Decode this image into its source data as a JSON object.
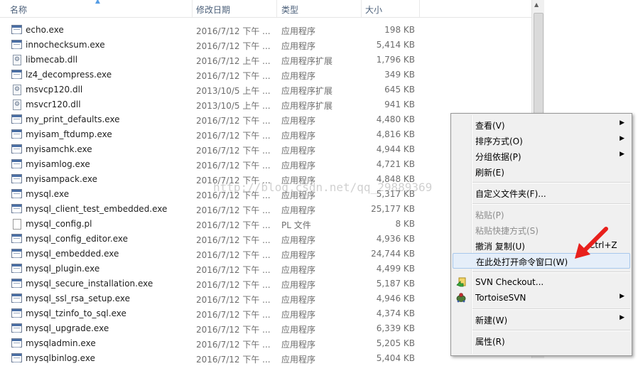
{
  "columns": {
    "name": "名称",
    "date": "修改日期",
    "type": "类型",
    "size": "大小"
  },
  "files": [
    {
      "name": "echo.exe",
      "date": "2016/7/12 下午 ...",
      "type": "应用程序",
      "size": "198 KB",
      "icon": "exe"
    },
    {
      "name": "innochecksum.exe",
      "date": "2016/7/12 下午 ...",
      "type": "应用程序",
      "size": "5,414 KB",
      "icon": "exe"
    },
    {
      "name": "libmecab.dll",
      "date": "2016/7/12 上午 ...",
      "type": "应用程序扩展",
      "size": "1,796 KB",
      "icon": "dll"
    },
    {
      "name": "lz4_decompress.exe",
      "date": "2016/7/12 下午 ...",
      "type": "应用程序",
      "size": "349 KB",
      "icon": "exe"
    },
    {
      "name": "msvcp120.dll",
      "date": "2013/10/5 上午 ...",
      "type": "应用程序扩展",
      "size": "645 KB",
      "icon": "dll"
    },
    {
      "name": "msvcr120.dll",
      "date": "2013/10/5 上午 ...",
      "type": "应用程序扩展",
      "size": "941 KB",
      "icon": "dll"
    },
    {
      "name": "my_print_defaults.exe",
      "date": "2016/7/12 下午 ...",
      "type": "应用程序",
      "size": "4,480 KB",
      "icon": "exe"
    },
    {
      "name": "myisam_ftdump.exe",
      "date": "2016/7/12 下午 ...",
      "type": "应用程序",
      "size": "4,816 KB",
      "icon": "exe"
    },
    {
      "name": "myisamchk.exe",
      "date": "2016/7/12 下午 ...",
      "type": "应用程序",
      "size": "4,944 KB",
      "icon": "exe"
    },
    {
      "name": "myisamlog.exe",
      "date": "2016/7/12 下午 ...",
      "type": "应用程序",
      "size": "4,721 KB",
      "icon": "exe"
    },
    {
      "name": "myisampack.exe",
      "date": "2016/7/12 下午 ...",
      "type": "应用程序",
      "size": "4,848 KB",
      "icon": "exe"
    },
    {
      "name": "mysql.exe",
      "date": "2016/7/12 下午 ...",
      "type": "应用程序",
      "size": "5,317 KB",
      "icon": "exe"
    },
    {
      "name": "mysql_client_test_embedded.exe",
      "date": "2016/7/12 下午 ...",
      "type": "应用程序",
      "size": "25,177 KB",
      "icon": "exe"
    },
    {
      "name": "mysql_config.pl",
      "date": "2016/7/12 下午 ...",
      "type": "PL 文件",
      "size": "8 KB",
      "icon": "pl"
    },
    {
      "name": "mysql_config_editor.exe",
      "date": "2016/7/12 下午 ...",
      "type": "应用程序",
      "size": "4,936 KB",
      "icon": "exe"
    },
    {
      "name": "mysql_embedded.exe",
      "date": "2016/7/12 下午 ...",
      "type": "应用程序",
      "size": "24,744 KB",
      "icon": "exe"
    },
    {
      "name": "mysql_plugin.exe",
      "date": "2016/7/12 下午 ...",
      "type": "应用程序",
      "size": "4,499 KB",
      "icon": "exe"
    },
    {
      "name": "mysql_secure_installation.exe",
      "date": "2016/7/12 下午 ...",
      "type": "应用程序",
      "size": "5,187 KB",
      "icon": "exe"
    },
    {
      "name": "mysql_ssl_rsa_setup.exe",
      "date": "2016/7/12 下午 ...",
      "type": "应用程序",
      "size": "4,946 KB",
      "icon": "exe"
    },
    {
      "name": "mysql_tzinfo_to_sql.exe",
      "date": "2016/7/12 下午 ...",
      "type": "应用程序",
      "size": "4,374 KB",
      "icon": "exe"
    },
    {
      "name": "mysql_upgrade.exe",
      "date": "2016/7/12 下午 ...",
      "type": "应用程序",
      "size": "6,339 KB",
      "icon": "exe"
    },
    {
      "name": "mysqladmin.exe",
      "date": "2016/7/12 下午 ...",
      "type": "应用程序",
      "size": "5,205 KB",
      "icon": "exe"
    },
    {
      "name": "mysqlbinlog.exe",
      "date": "2016/7/12 下午 ...",
      "type": "应用程序",
      "size": "5,404 KB",
      "icon": "exe"
    }
  ],
  "watermark": "http://blog.csdn.net/qq_29889369",
  "context_menu": {
    "view": "查看(V)",
    "sort_by": "排序方式(O)",
    "group_by": "分组依据(P)",
    "refresh": "刷新(E)",
    "customize_folder": "自定义文件夹(F)...",
    "paste": "粘贴(P)",
    "paste_shortcut": "粘贴快捷方式(S)",
    "undo_copy": "撤消 复制(U)",
    "undo_shortcut": "Ctrl+Z",
    "open_command_window": "在此处打开命令窗口(W)",
    "svn_checkout": "SVN Checkout...",
    "tortoise_svn": "TortoiseSVN",
    "new": "新建(W)",
    "properties": "属性(R)"
  },
  "colors": {
    "header_text": "#4c607a",
    "highlight": "#e5eef9",
    "arrow": "#e8201c"
  }
}
